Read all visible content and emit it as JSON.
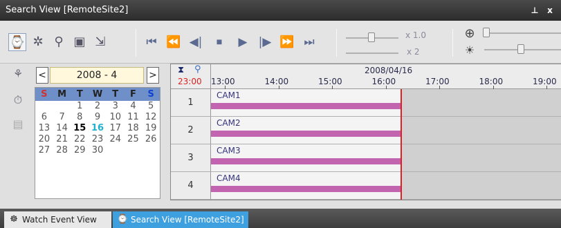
{
  "window": {
    "title": "Search View [RemoteSite2]",
    "pin_glyph": "ⅎ",
    "close_glyph": "x"
  },
  "toolbar": {
    "mode_icons": [
      "clock-search-icon",
      "event-search-icon",
      "motion-search-icon",
      "text-search-icon",
      "export-icon"
    ],
    "playback": [
      "⏮",
      "⏪",
      "◀|",
      "⏹",
      "▶",
      "|▶",
      "⏩",
      "⏭"
    ],
    "speed_label": "x 1.0",
    "step_label": "x 2",
    "zoom_icon": "⊕",
    "brightness_icon": "☀"
  },
  "left_icons": [
    "camera-select-icon",
    "clock-icon",
    "storage-icon"
  ],
  "calendar": {
    "prev": "<",
    "next": ">",
    "month_label": "2008 - 4",
    "weekdays": [
      "S",
      "M",
      "T",
      "W",
      "T",
      "F",
      "S"
    ],
    "weeks": [
      [
        "",
        "",
        "1",
        "2",
        "3",
        "4",
        "5"
      ],
      [
        "6",
        "7",
        "8",
        "9",
        "10",
        "11",
        "12"
      ],
      [
        "13",
        "14",
        "15",
        "16",
        "17",
        "18",
        "19"
      ],
      [
        "20",
        "21",
        "22",
        "23",
        "24",
        "25",
        "26"
      ],
      [
        "27",
        "28",
        "29",
        "30",
        "",
        "",
        ""
      ]
    ],
    "bold_days": [
      "15"
    ],
    "today": "16"
  },
  "timeline": {
    "current_time": "23:00",
    "date_label": "2008/04/16",
    "ticks": [
      "13:00",
      "14:00",
      "15:00",
      "16:00",
      "17:00",
      "18:00",
      "19:00"
    ],
    "cameras": [
      {
        "row": "1",
        "name": "CAM1"
      },
      {
        "row": "2",
        "name": "CAM2"
      },
      {
        "row": "3",
        "name": "CAM3"
      },
      {
        "row": "4",
        "name": "CAM4"
      }
    ],
    "recording_end": "16:30",
    "now_line_color": "#e02020",
    "recording_color": "#c264b0"
  },
  "tabs": [
    {
      "label": "Watch Event View",
      "icon": "watch-event-icon"
    },
    {
      "label": "Search View [RemoteSite2]",
      "icon": "search-view-icon"
    }
  ]
}
